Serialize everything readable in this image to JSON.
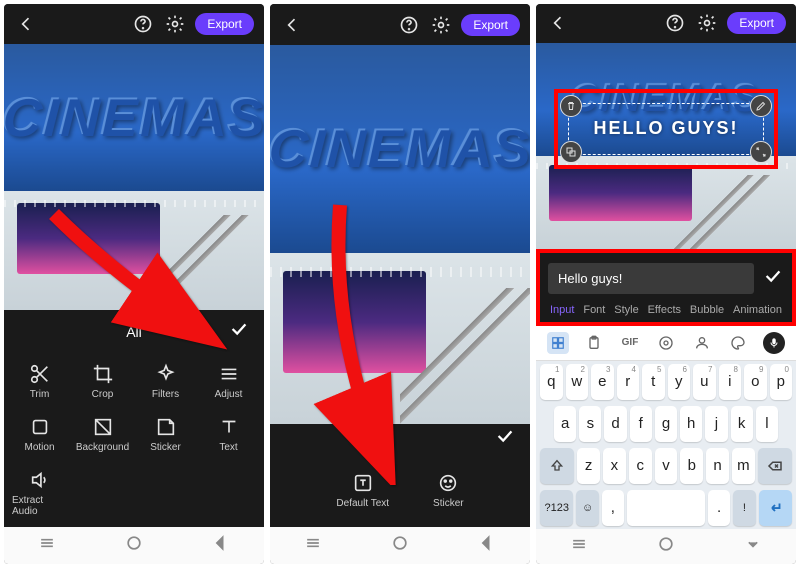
{
  "header": {
    "export_label": "Export"
  },
  "panel1": {
    "title": "All",
    "tools": [
      {
        "label": "Trim"
      },
      {
        "label": "Crop"
      },
      {
        "label": "Filters"
      },
      {
        "label": "Adjust"
      },
      {
        "label": "Motion"
      },
      {
        "label": "Background"
      },
      {
        "label": "Sticker"
      },
      {
        "label": "Text"
      },
      {
        "label": "Extract Audio"
      }
    ]
  },
  "panel2": {
    "default_text_label": "Default Text",
    "sticker_label": "Sticker"
  },
  "panel3": {
    "sign_text": "CINEMAS",
    "overlay_text": "HELLO GUYS!",
    "input_value": "Hello guys!",
    "tabs": [
      "Input",
      "Font",
      "Style",
      "Effects",
      "Bubble",
      "Animation"
    ],
    "kbd_func": "GIF",
    "num_label": "?123"
  },
  "scene": {
    "sign_text": "CINEMAS"
  },
  "keys": {
    "row1": [
      {
        "k": "q",
        "s": "1"
      },
      {
        "k": "w",
        "s": "2"
      },
      {
        "k": "e",
        "s": "3"
      },
      {
        "k": "r",
        "s": "4"
      },
      {
        "k": "t",
        "s": "5"
      },
      {
        "k": "y",
        "s": "6"
      },
      {
        "k": "u",
        "s": "7"
      },
      {
        "k": "i",
        "s": "8"
      },
      {
        "k": "o",
        "s": "9"
      },
      {
        "k": "p",
        "s": "0"
      }
    ],
    "row2": [
      {
        "k": "a"
      },
      {
        "k": "s"
      },
      {
        "k": "d"
      },
      {
        "k": "f"
      },
      {
        "k": "g"
      },
      {
        "k": "h"
      },
      {
        "k": "j"
      },
      {
        "k": "k"
      },
      {
        "k": "l"
      }
    ],
    "row3": [
      {
        "k": "z"
      },
      {
        "k": "x"
      },
      {
        "k": "c"
      },
      {
        "k": "v"
      },
      {
        "k": "b"
      },
      {
        "k": "n"
      },
      {
        "k": "m"
      }
    ]
  }
}
